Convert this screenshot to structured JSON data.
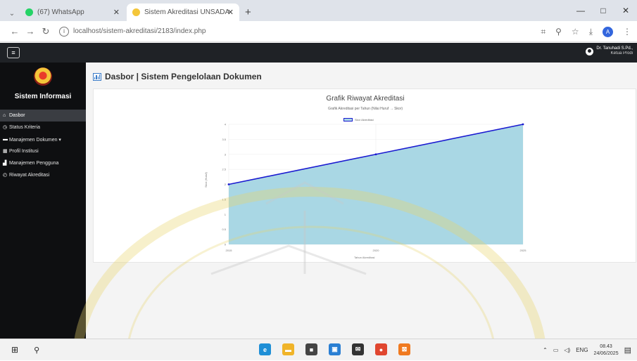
{
  "browser": {
    "tabs": [
      {
        "title": "(67) WhatsApp",
        "favicon_color": "#25d366",
        "active": false
      },
      {
        "title": "Sistem Akreditasi UNSADA",
        "favicon_color": "#f4c63a",
        "active": true
      }
    ],
    "new_tab": "+",
    "url": "localhost/sistem-akreditasi/2183/index.php",
    "window_controls": [
      "—",
      "□",
      "✕"
    ],
    "address_icons": [
      "translate-icon",
      "zoom-icon",
      "star-icon",
      "download-icon",
      "profile-icon",
      "more-icon"
    ],
    "profile_initial": "A"
  },
  "app": {
    "user_name": "Dr. Tanuhadi S.Pd.,",
    "user_role": "Ketua Prodi",
    "sidebar_title": "Sistem Informasi",
    "nav": [
      {
        "label": "Dasbor",
        "icon": "home-icon",
        "active": true
      },
      {
        "label": "Status Kriteria",
        "icon": "clock-icon",
        "active": false
      },
      {
        "label": "Manajemen Dokumen ▾",
        "icon": "folder-icon",
        "active": false
      },
      {
        "label": "Profil Institusi",
        "icon": "building-icon",
        "active": false
      },
      {
        "label": "Manajemen Pengguna",
        "icon": "users-icon",
        "active": false
      },
      {
        "label": "Riwayat Akreditasi",
        "icon": "history-icon",
        "active": false
      }
    ],
    "page_title": "Dasbor | Sistem Pengelolaan Dokumen"
  },
  "chart_data": {
    "type": "area",
    "title": "Grafik Riwayat Akreditasi",
    "subtitle": "Grafik Akreditasi per Tahun (Nilai Huruf → Skor)",
    "legend": "Skor Akreditasi",
    "x": [
      2015,
      2020,
      2025
    ],
    "xtick_labels": [
      "2015",
      "2020",
      "2025"
    ],
    "y": [
      2.0,
      3.0,
      4.0
    ],
    "yticks": [
      4,
      3.5,
      3,
      2.5,
      2,
      1.5,
      1,
      0.5,
      0
    ],
    "ylim": [
      0,
      4
    ],
    "ylabel": "Skor (Huruf)",
    "xlabel": "Tahun Akreditasi",
    "fill_color": "#a9d7e4",
    "line_color": "#1a1ad0",
    "grid": true
  },
  "taskbar": {
    "apps": [
      {
        "name": "edge-icon",
        "color": "#1f8fd6",
        "glyph": "e"
      },
      {
        "name": "files-icon",
        "color": "#f0b429",
        "glyph": "▬"
      },
      {
        "name": "store-icon",
        "color": "#444444",
        "glyph": "■"
      },
      {
        "name": "photos-icon",
        "color": "#2a7fd3",
        "glyph": "▣"
      },
      {
        "name": "mail-icon",
        "color": "#333333",
        "glyph": "✉"
      },
      {
        "name": "chrome-icon",
        "color": "#e0462f",
        "glyph": "●"
      },
      {
        "name": "xampp-icon",
        "color": "#f07a20",
        "glyph": "⊠"
      }
    ],
    "language": "ENG",
    "time": "08.43",
    "date": "24/06/2025"
  }
}
